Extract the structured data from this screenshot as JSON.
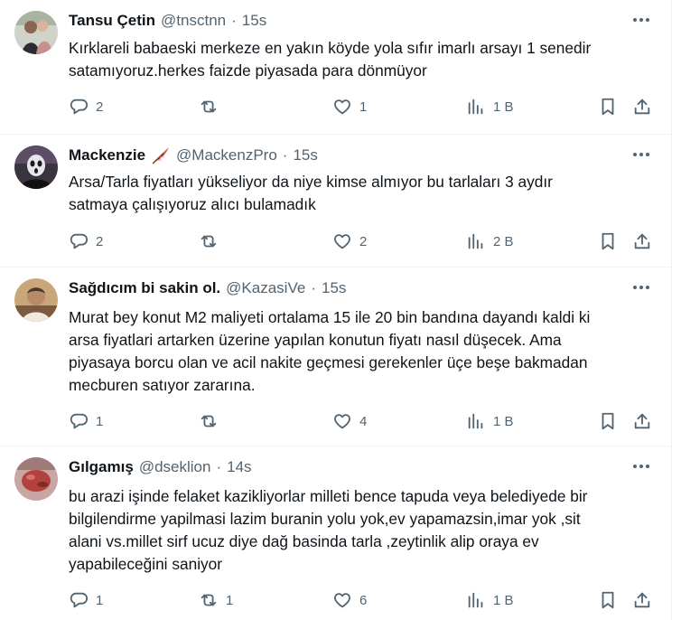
{
  "tweets": [
    {
      "name": "Tansu Çetin",
      "handle": "@tnsctnn",
      "separator": "·",
      "time": "15s",
      "text": "Kırklareli babaeski merkeze en yakın köyde yola sıfır imarlı arsayı 1 senedir\nsatamıyoruz.herkes faizde piyasada para dönmüyor",
      "replies": "2",
      "reposts": "",
      "likes": "1",
      "views": "1 B"
    },
    {
      "name": "Mackenzie",
      "handle": "@MackenzPro",
      "separator": "·",
      "time": "15s",
      "text": "Arsa/Tarla fiyatları yükseliyor da niye kimse almıyor bu tarlaları 3 aydır\nsatmaya çalışıyoruz alıcı bulamadık",
      "replies": "2",
      "reposts": "",
      "likes": "2",
      "views": "2 B"
    },
    {
      "name": "Sağdıcım bi sakin ol.",
      "handle": "@KazasiVe",
      "separator": "·",
      "time": "15s",
      "text": "Murat bey konut M2 maliyeti ortalama 15 ile 20 bin bandına dayandı kaldi ki\narsa fiyatlari artarken üzerine yapılan konutun fiyatı nasıl düşecek. Ama\npiyasaya borcu olan ve acil nakite geçmesi gerekenler üçe beşe bakmadan\nmecburen satıyor zararına.",
      "replies": "1",
      "reposts": "",
      "likes": "4",
      "views": "1 B"
    },
    {
      "name": "Gılgamış",
      "handle": "@dseklion",
      "separator": "·",
      "time": "14s",
      "text": "bu arazi işinde felaket kazikliyorlar milleti bence tapuda veya belediyede bir\nbilgilendirme yapilmasi lazim buranin yolu yok,ev yapamazsin,imar yok ,sit\nalani vs.millet sirf ucuz diye dağ basinda tarla ,zeytinlik alip oraya ev\nyapabileceğini saniyor",
      "replies": "1",
      "reposts": "1",
      "likes": "6",
      "views": "1 B"
    }
  ],
  "icons": {
    "reply": "reply-icon",
    "repost": "repost-icon",
    "like": "like-icon",
    "views": "views-icon",
    "bookmark": "bookmark-icon",
    "share": "share-icon",
    "more": "more-icon",
    "badge": "feather-icon"
  },
  "colors": {
    "text": "#0f1419",
    "muted": "#536471",
    "divider": "#eff3f4"
  }
}
